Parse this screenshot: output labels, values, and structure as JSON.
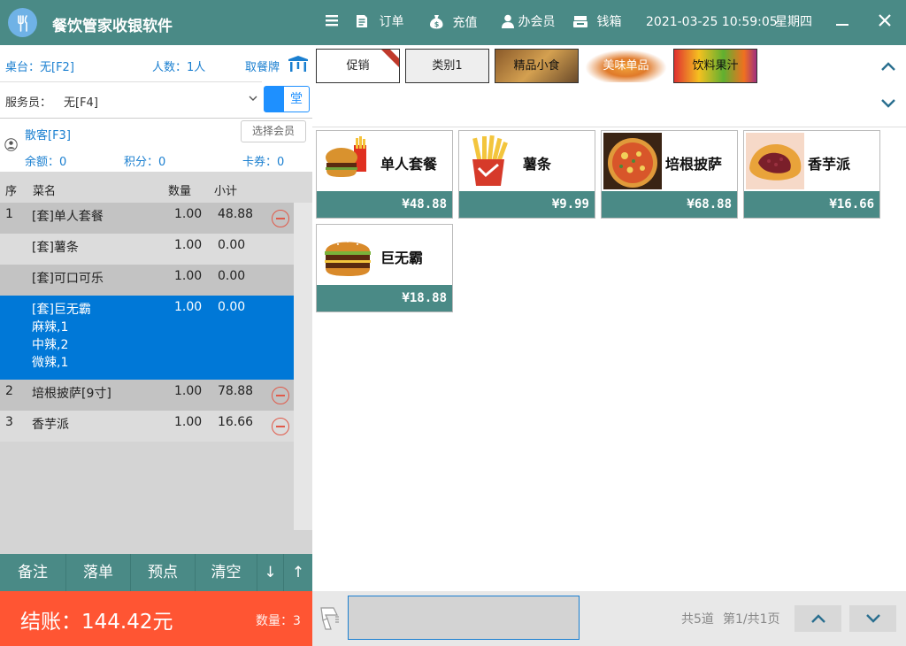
{
  "titlebar": {
    "app_name": "餐饮管家收银软件",
    "menu_orders": "订单",
    "menu_recharge": "充值",
    "menu_member": "办会员",
    "menu_cashbox": "钱箱",
    "datetime": "2021-03-25 10:59:05",
    "weekday": "星期四",
    "minimize_glyph": "—",
    "close_glyph": "✕"
  },
  "order_info": {
    "table": "桌台：无[F2]",
    "people": "人数：1人",
    "pickup_label": "取餐牌",
    "waiter_label": "服务员：",
    "waiter_value": "无[F4]",
    "hall_label": "堂",
    "guest": "散客[F3]",
    "select_member": "选择会员",
    "balance": "余额：0",
    "points": "积分：0",
    "coupons": "卡券：0"
  },
  "order_table": {
    "headers": [
      "序",
      "菜名",
      "数量",
      "小计"
    ],
    "rows": [
      {
        "seq": "1",
        "name": "[套]单人套餐",
        "qty": "1.00",
        "subtotal": "48.88",
        "removable": true,
        "selected": false,
        "extras": []
      },
      {
        "seq": "",
        "name": "[套]薯条",
        "qty": "1.00",
        "subtotal": "0.00",
        "removable": false,
        "selected": false,
        "extras": []
      },
      {
        "seq": "",
        "name": "[套]可口可乐",
        "qty": "1.00",
        "subtotal": "0.00",
        "removable": false,
        "selected": false,
        "extras": []
      },
      {
        "seq": "",
        "name": "[套]巨无霸",
        "qty": "1.00",
        "subtotal": "0.00",
        "removable": false,
        "selected": true,
        "extras": [
          "麻辣,1",
          "中辣,2",
          "微辣,1"
        ]
      },
      {
        "seq": "2",
        "name": "培根披萨[9寸]",
        "qty": "1.00",
        "subtotal": "78.88",
        "removable": true,
        "selected": false,
        "extras": []
      },
      {
        "seq": "3",
        "name": "香芋派",
        "qty": "1.00",
        "subtotal": "16.66",
        "removable": true,
        "selected": false,
        "extras": []
      }
    ]
  },
  "actions": {
    "note": "备注",
    "place_order": "落单",
    "preorder": "预点",
    "clear": "清空",
    "down": "↓",
    "up": "↑"
  },
  "checkout": {
    "total_label": "结账：144.42元",
    "quantity_label": "数量：3"
  },
  "categories": [
    {
      "label": "促销",
      "badge": "促销",
      "style": "plain"
    },
    {
      "label": "类别1",
      "badge": "",
      "style": "gray"
    },
    {
      "label": "精品小食",
      "badge": "",
      "style": "image"
    },
    {
      "label": "美味单品",
      "badge": "",
      "style": "image"
    },
    {
      "label": "饮料果汁",
      "badge": "",
      "style": "image"
    }
  ],
  "products": [
    {
      "name": "单人套餐",
      "price": "¥48.88",
      "icon": "burger-combo-icon"
    },
    {
      "name": "薯条",
      "price": "¥9.99",
      "icon": "fries-icon"
    },
    {
      "name": "培根披萨",
      "price": "¥68.88",
      "icon": "pizza-icon"
    },
    {
      "name": "香芋派",
      "price": "¥16.66",
      "icon": "taro-pie-icon"
    },
    {
      "name": "巨无霸",
      "price": "¥18.88",
      "icon": "big-burger-icon"
    }
  ],
  "pagination": {
    "total_dishes": "共5道",
    "page_info": "第1/共1页"
  },
  "scan_input": {
    "value": ""
  },
  "colors": {
    "teal": "#4a8a86",
    "checkout_red": "#ff5533",
    "selected_blue": "#0078d7",
    "accent_blue": "#1a7fd0"
  }
}
